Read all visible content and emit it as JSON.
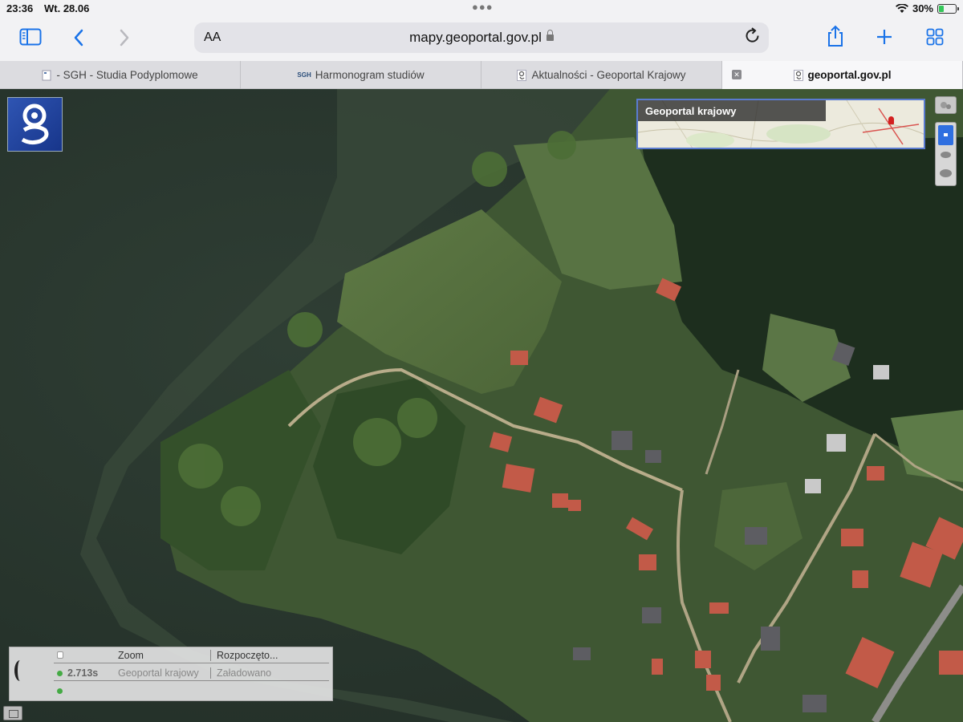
{
  "status_bar": {
    "time": "23:36",
    "date": "Wt. 28.06",
    "battery_text": "30%",
    "battery_level": 0.3
  },
  "toolbar": {
    "text_size_label": "AA",
    "url": "mapy.geoportal.gov.pl",
    "icons": [
      "sidebar-icon",
      "back-icon",
      "forward-icon",
      "share-icon",
      "new-tab-icon",
      "tab-overview-icon"
    ]
  },
  "tabs": [
    {
      "label": "- SGH - Studia Podyplomowe",
      "active": false
    },
    {
      "label": "Harmonogram studiów",
      "active": false,
      "favicon_text": "SGH"
    },
    {
      "label": "Aktualności - Geoportal Krajowy",
      "active": false
    },
    {
      "label": "geoportal.gov.pl",
      "active": true
    }
  ],
  "map": {
    "minimap_title": "Geoportal krajowy",
    "colors": {
      "water": "#2b3a31",
      "forest": "#1d2e1e",
      "meadow": "#4f6a3b",
      "roof": "#c25a48"
    }
  },
  "log_panel": {
    "rows": [
      {
        "col1": "",
        "col2": "Zoom",
        "col3": "Rozpoczęto..."
      },
      {
        "col1": "2.713s",
        "col2": "Geoportal krajowy",
        "col3": "Załadowano"
      },
      {
        "col1": "",
        "col2": "",
        "col3": ""
      }
    ]
  }
}
